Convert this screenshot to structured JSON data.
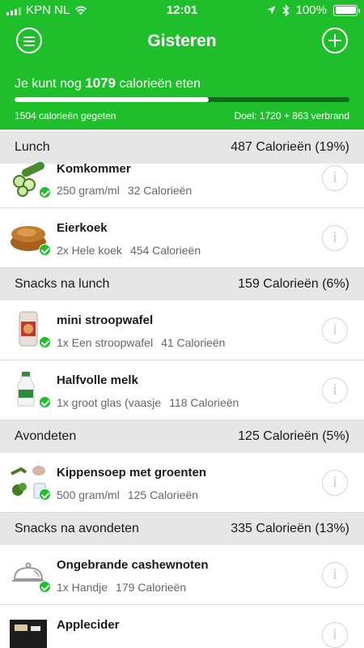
{
  "status_bar": {
    "carrier": "KPN NL",
    "time": "12:01",
    "battery": "100%",
    "battery_level": 1.0
  },
  "header": {
    "title": "Gisteren",
    "budget_prefix": "Je kunt nog",
    "budget_value": "1079",
    "budget_suffix": "calorieën eten",
    "progress": 0.58,
    "eaten": "1504 calorieën gegeten",
    "goal": "Doel: 1720 + 863 verbrand",
    "menu_icon": "menu-icon",
    "add_icon": "add-icon",
    "accent": "#1fbf2b"
  },
  "meals": [
    {
      "name": "Lunch",
      "total": "487 Calorieën (19%)",
      "items": [
        {
          "name": "Komkommer",
          "portion": "250 gram/ml",
          "calories": "32 Calorieën",
          "icon": "cucumber-icon"
        },
        {
          "name": "Eierkoek",
          "portion": "2x Hele koek",
          "calories": "454 Calorieën",
          "icon": "cake-icon"
        }
      ]
    },
    {
      "name": "Snacks na lunch",
      "total": "159 Calorieën (6%)",
      "items": [
        {
          "name": "mini stroopwafel",
          "portion": "1x  Een stroopwafel",
          "calories": "41 Calorieën",
          "icon": "stroopwafel-icon"
        },
        {
          "name": "Halfvolle melk",
          "portion": "1x groot glas (vaasje",
          "calories": "118 Calorieën",
          "icon": "milk-icon"
        }
      ]
    },
    {
      "name": "Avondeten",
      "total": "125 Calorieën (5%)",
      "items": [
        {
          "name": "Kippensoep met groenten",
          "portion": "500 gram/ml",
          "calories": "125 Calorieën",
          "icon": "soup-icon"
        }
      ]
    },
    {
      "name": "Snacks na avondeten",
      "total": "335 Calorieën (13%)",
      "items": [
        {
          "name": "Ongebrande cashewnoten",
          "portion": "1x Handje",
          "calories": "179 Calorieën",
          "icon": "placeholder-food-icon"
        },
        {
          "name": "Applecider",
          "portion": "",
          "calories": "",
          "icon": "bottle-icon"
        }
      ]
    }
  ]
}
